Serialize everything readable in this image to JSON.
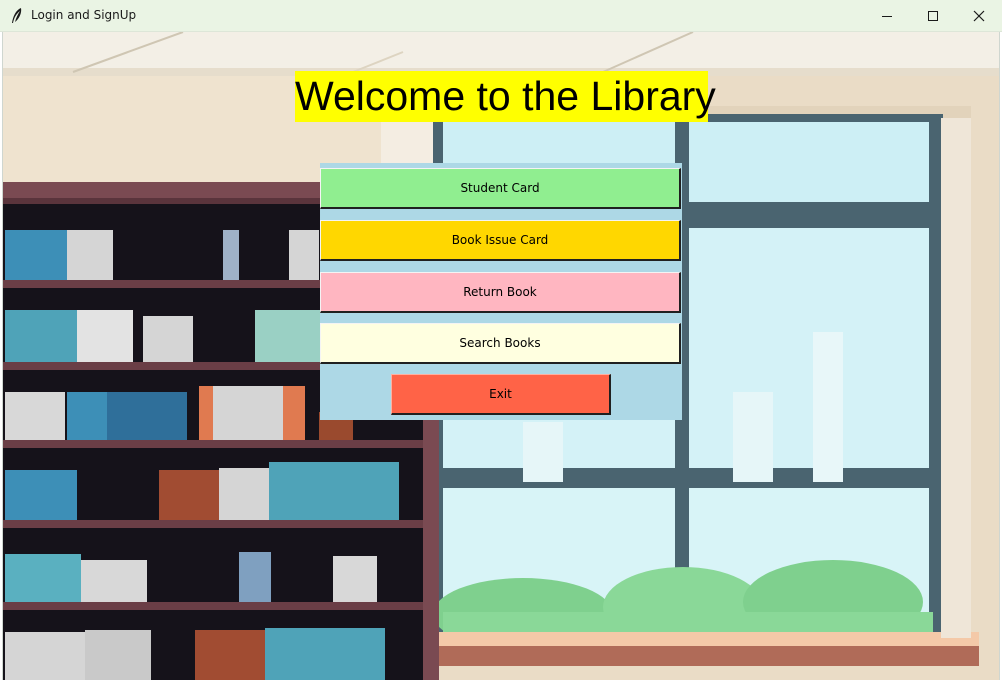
{
  "window": {
    "title": "Login and SignUp"
  },
  "heading": "Welcome to the Library",
  "menu": {
    "student_card": "Student Card",
    "book_issue_card": "Book Issue Card",
    "return_book": "Return Book",
    "search_books": "Search Books",
    "exit": "Exit"
  },
  "colors": {
    "heading_bg": "#ffff00",
    "panel_bg": "#add8e6",
    "student_card": "#90ee90",
    "book_issue_card": "#ffd700",
    "return_book": "#ffb6c1",
    "search_books": "#ffffe0",
    "exit": "#ff6347"
  }
}
